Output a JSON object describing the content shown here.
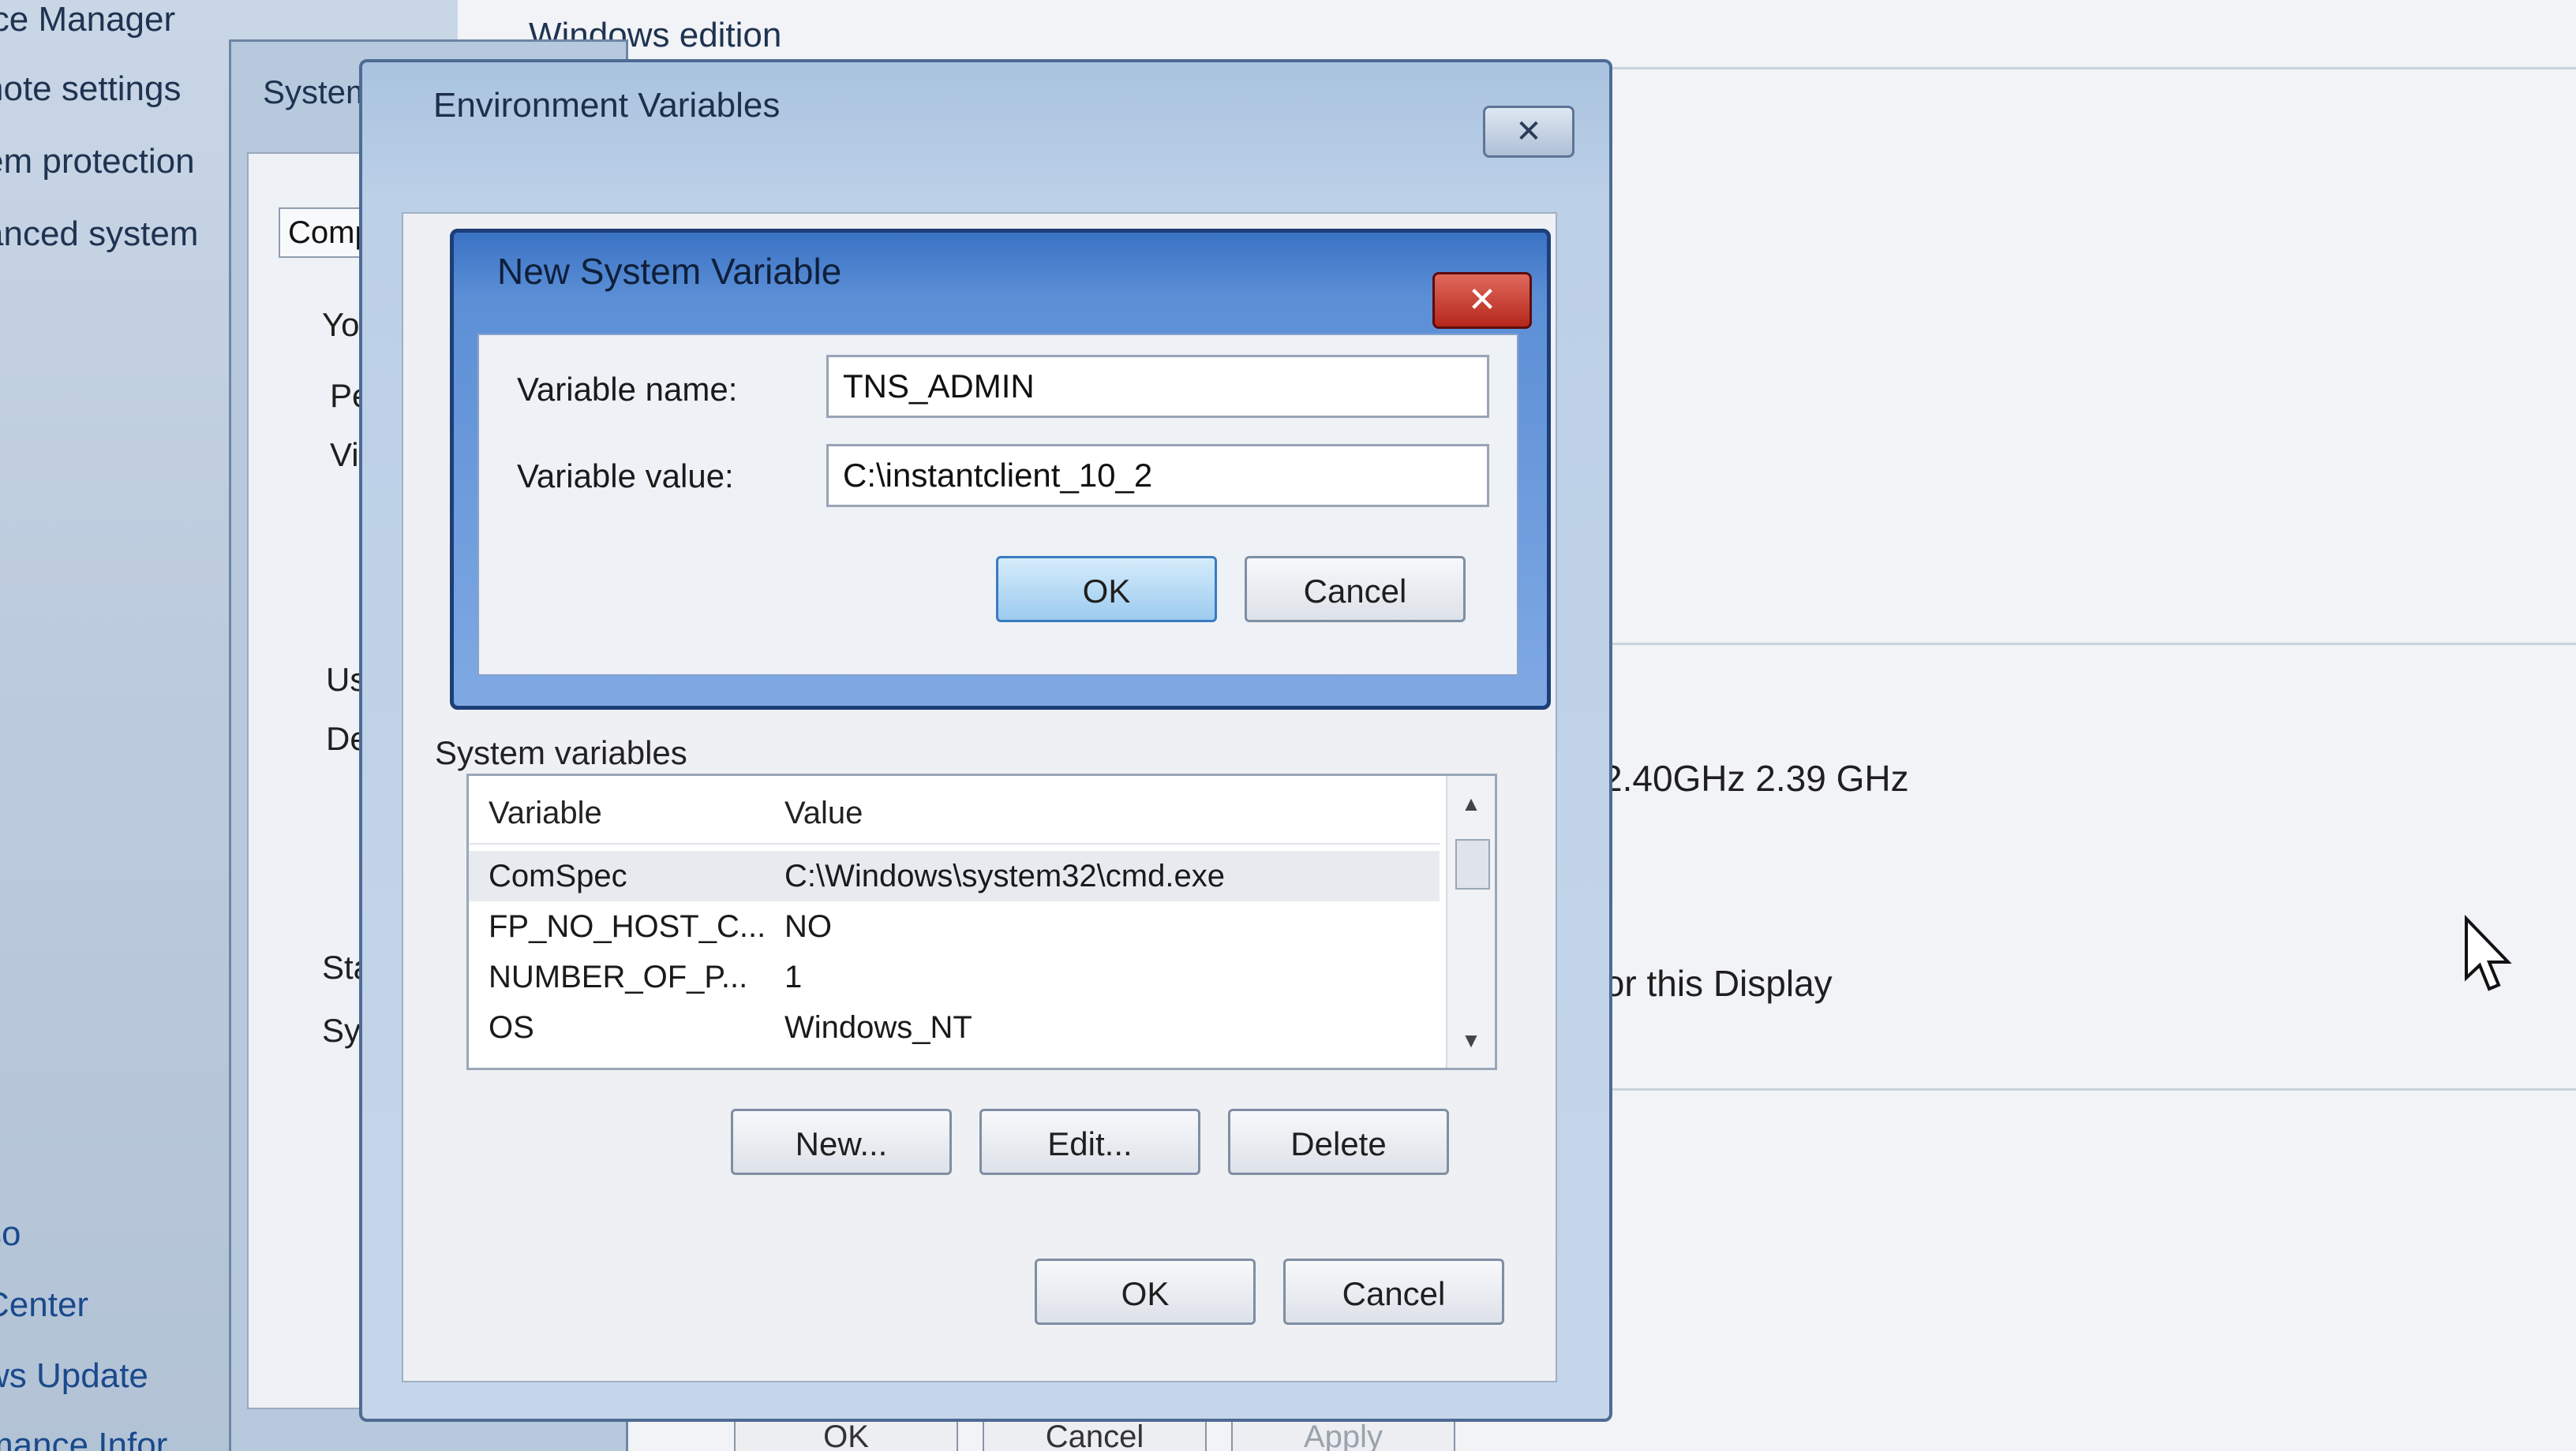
{
  "left_panel": {
    "items_top": [
      "ice Manager",
      "note settings",
      "em protection",
      "anced system"
    ],
    "items_bottom": [
      "so",
      "Center",
      "ws Update",
      "mance Infor"
    ]
  },
  "background_window": {
    "section_title": "Windows edition",
    "processor_text": "2.40GHz   2.39 GHz",
    "display_text": "for this Display"
  },
  "system_properties": {
    "tab_label": "System",
    "subtab_label": "Compu",
    "fragments": [
      "You",
      "Perf",
      "Visu",
      "Use",
      "Des",
      "Star",
      "Sys"
    ],
    "bottom_buttons": [
      "OK",
      "Cancel",
      "Apply"
    ]
  },
  "environment_dialog": {
    "title": "Environment Variables",
    "close_label": "✕",
    "system_variables_label": "System variables",
    "list_headers": {
      "variable": "Variable",
      "value": "Value"
    },
    "rows": [
      {
        "variable": "ComSpec",
        "value": "C:\\Windows\\system32\\cmd.exe"
      },
      {
        "variable": "FP_NO_HOST_C...",
        "value": "NO"
      },
      {
        "variable": "NUMBER_OF_P...",
        "value": "1"
      },
      {
        "variable": "OS",
        "value": "Windows_NT"
      }
    ],
    "new_button": "New...",
    "edit_button": "Edit...",
    "delete_button": "Delete",
    "ok_button": "OK",
    "cancel_button": "Cancel"
  },
  "new_variable_dialog": {
    "title": "New System Variable",
    "close_label": "✕",
    "name_label": "Variable name:",
    "name_value": "TNS_ADMIN",
    "value_label": "Variable value:",
    "value_value": "C:\\instantclient_10_2",
    "ok_button": "OK",
    "cancel_button": "Cancel"
  }
}
